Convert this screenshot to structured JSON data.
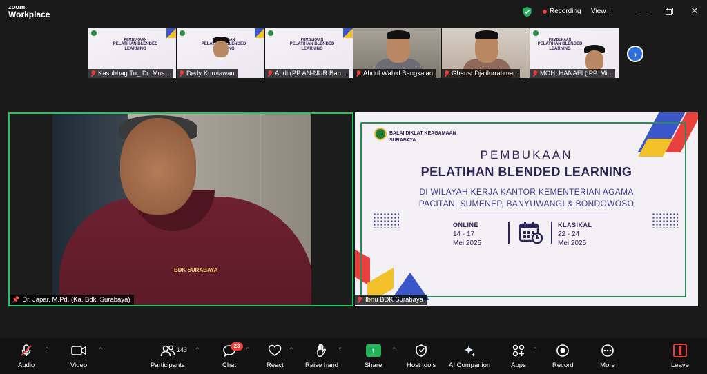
{
  "app": {
    "brand_line1": "zoom",
    "brand_line2": "Workplace",
    "recording_label": "Recording",
    "view_label": "View",
    "colors": {
      "accent": "#2d6fd9",
      "active_speaker": "#22c55e",
      "recording": "#e8403c",
      "share": "#22b35a"
    }
  },
  "thumbnails": [
    {
      "name": "Kasubbag Tu_ Dr. Mus...",
      "kind": "slide",
      "muted": true
    },
    {
      "name": "Dedy Kurniawan",
      "kind": "slide-cam",
      "muted": true
    },
    {
      "name": "Andi (PP AN-NUR Ban...",
      "kind": "slide",
      "muted": true
    },
    {
      "name": "Abdul Wahid Bangkalan",
      "kind": "cam",
      "muted": true
    },
    {
      "name": "Ghaust Djalilurrahman",
      "kind": "cam",
      "muted": true
    },
    {
      "name": "MOH. HANAFI ( PP. Mi...",
      "kind": "slide-cam",
      "muted": true
    }
  ],
  "thumb_slide": {
    "title1": "PEMBUKAAN",
    "title2": "PELATIHAN BLENDED LEARNING"
  },
  "speaker": {
    "name": "Dr. Japar, M.Pd. (Ka. Bdk. Surabaya)",
    "badge": "BDK SURABAYA"
  },
  "share": {
    "presenter": "Ibnu BDK Surabaya",
    "org_line1": "BALAI DIKLAT KEAGAMAAN",
    "org_line2": "SURABAYA",
    "title1": "PEMBUKAAN",
    "title2": "PELATIHAN BLENDED LEARNING",
    "subtitle1": "DI WILAYAH KERJA KANTOR KEMENTERIAN AGAMA",
    "subtitle2": "PACITAN, SUMENEP, BANYUWANGI & BONDOWOSO",
    "online_label": "ONLINE",
    "online_dates": "14 - 17",
    "online_month": "Mei 2025",
    "klasikal_label": "KLASIKAL",
    "klasikal_dates": "22 - 24",
    "klasikal_month": "Mei 2025"
  },
  "toolbar": {
    "audio": "Audio",
    "video": "Video",
    "participants": "Participants",
    "participants_count": "143",
    "chat": "Chat",
    "chat_badge": "23",
    "react": "React",
    "raise_hand": "Raise hand",
    "share": "Share",
    "host_tools": "Host tools",
    "ai_companion": "AI Companion",
    "apps": "Apps",
    "record": "Record",
    "more": "More",
    "leave": "Leave"
  }
}
